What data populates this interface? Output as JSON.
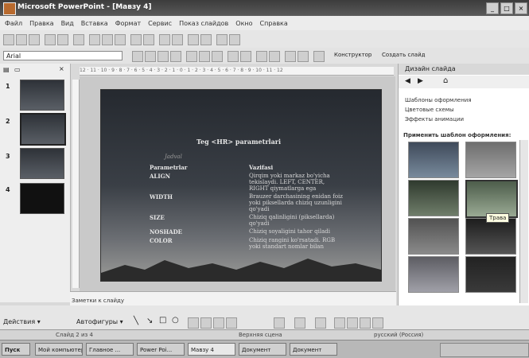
{
  "window": {
    "title": "Microsoft PowerPoint - [Мавзу 4]",
    "btns": [
      "_",
      "□",
      "×"
    ]
  },
  "menu": [
    "Файл",
    "Правка",
    "Вид",
    "Вставка",
    "Формат",
    "Сервис",
    "Показ слайдов",
    "Окно",
    "Справка"
  ],
  "font": {
    "name": "Arial"
  },
  "toolbar": {
    "constructor": "Конструктор",
    "new_slide": "Создать слайд"
  },
  "thumbs": [
    {
      "num": "1"
    },
    {
      "num": "2"
    },
    {
      "num": "3"
    },
    {
      "num": "4"
    }
  ],
  "ruler_text": "12 · 11 · 10 · 9 · 8 · 7 · 6 · 5 · 4 · 3 · 2 · 1 · 0 · 1 · 2 · 3 · 4 · 5 · 6 · 7 · 8 · 9 · 10 · 11 · 12",
  "slide": {
    "title": "Teg <HR> parametrlari",
    "sub": "Jadval",
    "head": {
      "k": "Parametrlar",
      "v": "Vazifasi"
    },
    "rows": [
      {
        "k": "ALIGN",
        "v": "Qirqim yoki markaz bo'yicha tekislaydi. LEFT, CENTER, RIGHT qiymatlarga ega"
      },
      {
        "k": "WIDTH",
        "v": "Brauzer darchasining enidan foiz yoki piksellarda chiziq uzunligini qo'yadi"
      },
      {
        "k": "SIZE",
        "v": "Chiziq qalinligini (piksellarda) qo'yadi"
      },
      {
        "k": "NOSHADE",
        "v": "Chiziq soyaligini tahor qiladi"
      },
      {
        "k": "COLOR",
        "v": "Chiziq rangini ko'rsatadi. RGB yoki standart nomlar bilan"
      }
    ]
  },
  "notes": {
    "label": "Заметки к слайду"
  },
  "taskpane": {
    "title": "Дизайн слайда",
    "items": [
      "Шаблоны оформления",
      "Цветовые схемы",
      "Эффекты анимации"
    ],
    "apply": "Применить шаблон оформления:",
    "tooltip": "Трава"
  },
  "drawbar": {
    "actions": "Действия ▾",
    "autoshapes": "Автофигуры ▾"
  },
  "status": {
    "slide": "Слайд 2 из 4",
    "design": "Верхняя сцена",
    "lang": "русский (Россия)"
  },
  "taskbar": {
    "start": "Пуск",
    "tasks": [
      "Мой компьютер",
      "Главное ...",
      "Power Poi...",
      "Мавзу 4",
      "Документ",
      "Документ"
    ]
  }
}
